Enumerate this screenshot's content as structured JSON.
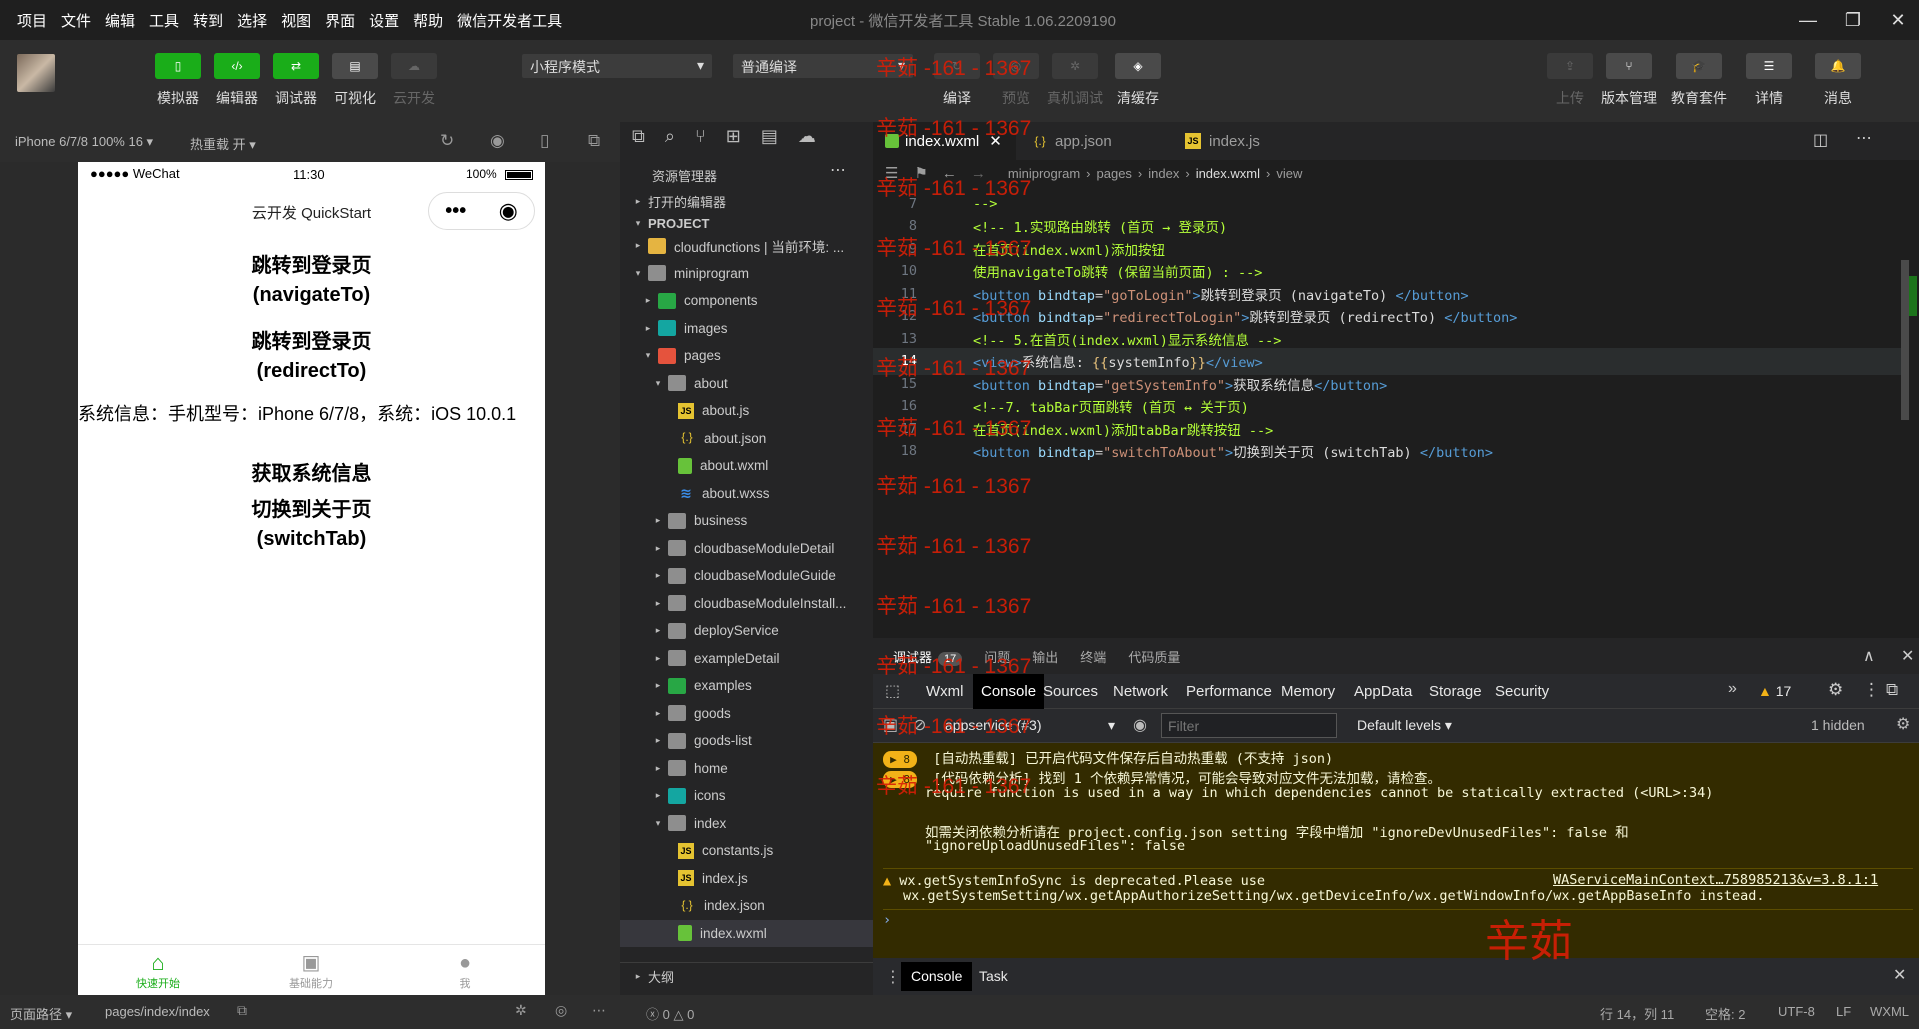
{
  "menu": [
    "项目",
    "文件",
    "编辑",
    "工具",
    "转到",
    "选择",
    "视图",
    "界面",
    "设置",
    "帮助",
    "微信开发者工具"
  ],
  "window_title": "project - 微信开发者工具 Stable 1.06.2209190",
  "toolbar": {
    "left_buttons": [
      {
        "label": "模拟器",
        "icon": "phone-icon"
      },
      {
        "label": "编辑器",
        "icon": "code-icon"
      },
      {
        "label": "调试器",
        "icon": "debug-icon"
      },
      {
        "label": "可视化",
        "icon": "layout-icon"
      },
      {
        "label": "云开发",
        "icon": "cloud-icon"
      }
    ],
    "mode_select": "小程序模式",
    "compile_select": "普通编译",
    "mid_buttons": [
      "编译",
      "预览",
      "真机调试",
      "清缓存"
    ],
    "right_buttons": [
      "上传",
      "版本管理",
      "教育套件",
      "详情",
      "消息"
    ]
  },
  "simulator": {
    "device": "iPhone 6/7/8 100% 16",
    "hot_reload": "热重载 开",
    "status_carrier": "●●●●● WeChat",
    "status_time": "11:30",
    "status_battery": "100%",
    "nav_title": "云开发 QuickStart",
    "buttons": [
      {
        "label": "跳转到登录页\n(navigateTo)"
      },
      {
        "label": "跳转到登录页\n(redirectTo)"
      }
    ],
    "system_info": "系统信息：手机型号：iPhone 6/7/8，系统：iOS 10.0.1",
    "btn_sysinfo": "获取系统信息",
    "btn_switch": "切换到关于页\n(switchTab)",
    "tabbar": [
      {
        "label": "快速开始",
        "icon": "home-icon",
        "color": "#1aad19"
      },
      {
        "label": "基础能力",
        "icon": "terminal-icon",
        "color": "#999"
      },
      {
        "label": "我",
        "icon": "user-icon",
        "color": "#999"
      }
    ],
    "page_path_label": "页面路径",
    "page_path": "pages/index/index"
  },
  "explorer": {
    "title": "资源管理器",
    "open_editors": "打开的编辑器",
    "project": "PROJECT",
    "outline": "大纲",
    "tree": [
      {
        "label": "cloudfunctions | 当前环境: ...",
        "indent": 1,
        "caret": "▸",
        "icon": "folder yel"
      },
      {
        "label": "miniprogram",
        "indent": 1,
        "caret": "▾",
        "icon": "folder"
      },
      {
        "label": "components",
        "indent": 2,
        "caret": "▸",
        "icon": "folder col"
      },
      {
        "label": "images",
        "indent": 2,
        "caret": "▸",
        "icon": "folder img"
      },
      {
        "label": "pages",
        "indent": 2,
        "caret": "▾",
        "icon": "folder red"
      },
      {
        "label": "about",
        "indent": 3,
        "caret": "▾",
        "icon": "folder"
      },
      {
        "label": "about.js",
        "indent": 4,
        "caret": "",
        "icon": "js"
      },
      {
        "label": "about.json",
        "indent": 4,
        "caret": "",
        "icon": "json"
      },
      {
        "label": "about.wxml",
        "indent": 4,
        "caret": "",
        "icon": "wxml"
      },
      {
        "label": "about.wxss",
        "indent": 4,
        "caret": "",
        "icon": "wxss"
      },
      {
        "label": "business",
        "indent": 3,
        "caret": "▸",
        "icon": "folder"
      },
      {
        "label": "cloudbaseModuleDetail",
        "indent": 3,
        "caret": "▸",
        "icon": "folder"
      },
      {
        "label": "cloudbaseModuleGuide",
        "indent": 3,
        "caret": "▸",
        "icon": "folder"
      },
      {
        "label": "cloudbaseModuleInstall...",
        "indent": 3,
        "caret": "▸",
        "icon": "folder"
      },
      {
        "label": "deployService",
        "indent": 3,
        "caret": "▸",
        "icon": "folder"
      },
      {
        "label": "exampleDetail",
        "indent": 3,
        "caret": "▸",
        "icon": "folder"
      },
      {
        "label": "examples",
        "indent": 3,
        "caret": "▸",
        "icon": "folder col"
      },
      {
        "label": "goods",
        "indent": 3,
        "caret": "▸",
        "icon": "folder"
      },
      {
        "label": "goods-list",
        "indent": 3,
        "caret": "▸",
        "icon": "folder"
      },
      {
        "label": "home",
        "indent": 3,
        "caret": "▸",
        "icon": "folder"
      },
      {
        "label": "icons",
        "indent": 3,
        "caret": "▸",
        "icon": "folder img"
      },
      {
        "label": "index",
        "indent": 3,
        "caret": "▾",
        "icon": "folder"
      },
      {
        "label": "constants.js",
        "indent": 4,
        "caret": "",
        "icon": "js"
      },
      {
        "label": "index.js",
        "indent": 4,
        "caret": "",
        "icon": "js"
      },
      {
        "label": "index.json",
        "indent": 4,
        "caret": "",
        "icon": "json"
      },
      {
        "label": "index.wxml",
        "indent": 4,
        "caret": "",
        "icon": "wxml",
        "selected": true
      }
    ]
  },
  "editor": {
    "tabs": [
      {
        "label": "index.wxml",
        "active": true,
        "icon": "wxml"
      },
      {
        "label": "app.json",
        "icon": "json"
      },
      {
        "label": "index.js",
        "icon": "js"
      }
    ],
    "breadcrumb": [
      "miniprogram",
      "pages",
      "index",
      "index.wxml",
      "view"
    ],
    "lines": [
      {
        "n": "7",
        "html": "<span class='cmt'>--></span>"
      },
      {
        "n": "8",
        "html": "<span class='cmt'>&lt;!-- 1.实现路由跳转 (首页 → 登录页)</span>"
      },
      {
        "n": "9",
        "html": "<span class='cmt'>在首页(index.wxml)添加按钮</span>"
      },
      {
        "n": "10",
        "html": "<span class='cmt'>使用navigateTo跳转 (保留当前页面) : --></span>"
      },
      {
        "n": "11",
        "html": "<span class='tag'>&lt;button</span> <span class='attr'>bindtap</span>=<span class='str'>\"goToLogin\"</span><span class='tag'>&gt;</span><span class='txt'>跳转到登录页 (navigateTo) </span><span class='tag'>&lt;/button&gt;</span>"
      },
      {
        "n": "12",
        "html": "<span class='tag'>&lt;button</span> <span class='attr'>bindtap</span>=<span class='str'>\"redirectToLogin\"</span><span class='tag'>&gt;</span><span class='txt'>跳转到登录页 (redirectTo) </span><span class='tag'>&lt;/button&gt;</span>"
      },
      {
        "n": "13",
        "html": "<span class='cmt'>&lt;!-- 5.在首页(index.wxml)显示系统信息 --></span>"
      },
      {
        "n": "14",
        "html": "<span class='tag'>&lt;view&gt;</span><span class='txt'>系统信息: </span><span class='brc'>{{</span><span class='txt'>systemInfo</span><span class='brc'>}}</span><span class='tag'>&lt;/view&gt;</span>",
        "current": true
      },
      {
        "n": "15",
        "html": "<span class='tag'>&lt;button</span> <span class='attr'>bindtap</span>=<span class='str'>\"getSystemInfo\"</span><span class='tag'>&gt;</span><span class='txt'>获取系统信息</span><span class='tag'>&lt;/button&gt;</span>"
      },
      {
        "n": "16",
        "html": "<span class='cmt'>&lt;!--7. tabBar页面跳转 (首页 ↔ 关于页)</span>"
      },
      {
        "n": "17",
        "html": "<span class='cmt'>在首页(index.wxml)添加tabBar跳转按钮 --></span>"
      },
      {
        "n": "18",
        "html": "<span class='tag'>&lt;button</span> <span class='attr'>bindtap</span>=<span class='str'>\"switchToAbout\"</span><span class='tag'>&gt;</span><span class='txt'>切换到关于页 (switchTab) </span><span class='tag'>&lt;/button&gt;</span>"
      }
    ]
  },
  "debug": {
    "tabs": [
      "调试器",
      "问题",
      "输出",
      "终端",
      "代码质量"
    ],
    "badge": "17",
    "devtools_tabs": [
      "Wxml",
      "Console",
      "Sources",
      "Network",
      "Performance",
      "Memory",
      "AppData",
      "Storage",
      "Security"
    ],
    "warn_count": "17",
    "context": "appservice (#3)",
    "filter_placeholder": "Filter",
    "levels": "Default levels",
    "hidden": "1 hidden",
    "logs": [
      {
        "badge": "8",
        "text": "[自动热重载] 已开启代码文件保存后自动热重载 (不支持 json)"
      },
      {
        "badge": "8",
        "text": "[代码依赖分析] 找到 1 个依赖异常情况，可能会导致对应文件无法加载，请检查。"
      },
      {
        "text": "require function is used in a way in which dependencies cannot be statically extracted (<URL>:34)"
      },
      {
        "text": "如需关闭依赖分析请在 project.config.json setting 字段中增加 \"ignoreDevUnusedFiles\": false 和"
      },
      {
        "text": "\"ignoreUploadUnusedFiles\": false"
      },
      {
        "text": "wx.getSystemInfoSync is deprecated.Please use",
        "link": "WAServiceMainContext…758985213&v=3.8.1:1"
      },
      {
        "text": "wx.getSystemSetting/wx.getAppAuthorizeSetting/wx.getDeviceInfo/wx.getWindowInfo/wx.getAppBaseInfo instead."
      }
    ],
    "drawer_tabs": [
      "Console",
      "Task"
    ]
  },
  "statusbar": {
    "errors": "0",
    "warnings": "0",
    "pos": "行 14，列 11",
    "spaces": "空格: 2",
    "encoding": "UTF-8",
    "eol": "LF",
    "lang": "WXML"
  },
  "watermarks": {
    "small": "辛茹 -161 - 1367",
    "big": "辛茹"
  },
  "colors": {
    "accent": "#1aad19",
    "warn_bg": "#332b00",
    "watermark": "#d81e06"
  }
}
